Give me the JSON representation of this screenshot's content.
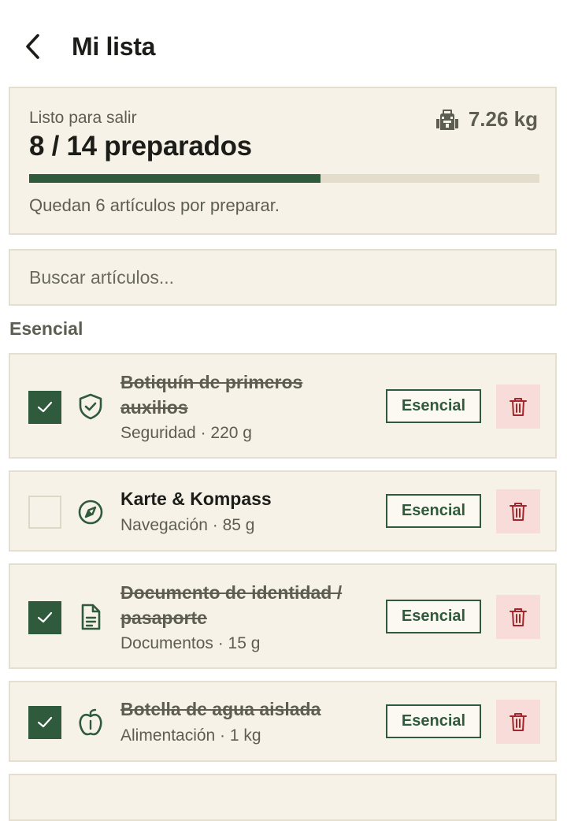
{
  "header": {
    "title": "Mi lista",
    "back_icon": "chevron-left-icon"
  },
  "summary": {
    "eyebrow": "Listo para salir",
    "count_label": "8 / 14 preparados",
    "packed": 8,
    "total": 14,
    "progress_fraction": 0.571,
    "weight": "7.26 kg",
    "weight_icon": "backpack-icon",
    "remaining": "Quedan 6 artículos por preparar."
  },
  "search": {
    "placeholder": "Buscar artículos...",
    "value": ""
  },
  "section": {
    "title": "Esencial"
  },
  "items": [
    {
      "name": "Botiquín de primeros auxilios",
      "meta": "Seguridad · 220 g",
      "checked": true,
      "icon": "shield-check-icon",
      "tag": "Esencial"
    },
    {
      "name": "Karte & Kompass",
      "meta": "Navegación · 85 g",
      "checked": false,
      "icon": "compass-icon",
      "tag": "Esencial"
    },
    {
      "name": "Documento de identidad / pasaporte",
      "meta": "Documentos · 15 g",
      "checked": true,
      "icon": "document-icon",
      "tag": "Esencial"
    },
    {
      "name": "Botella de agua aislada",
      "meta": "Alimentación · 1 kg",
      "checked": true,
      "icon": "apple-icon",
      "tag": "Esencial"
    }
  ],
  "colors": {
    "accent": "#2f5b3c",
    "card": "#f6f2e8",
    "border": "#e5dfcf",
    "danger_bg": "#f8dcd9",
    "danger": "#a3262b"
  }
}
